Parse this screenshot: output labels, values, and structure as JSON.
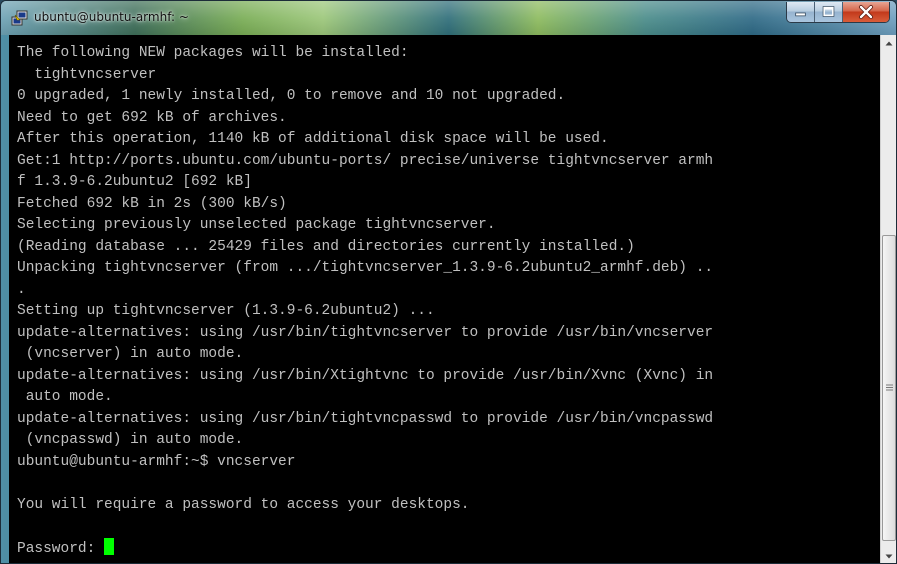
{
  "window": {
    "title": "ubuntu@ubuntu-armhf: ~"
  },
  "icons": {
    "app": "putty-icon",
    "minimize": "minimize-icon",
    "maximize": "maximize-icon",
    "close": "close-icon",
    "scroll_up": "scroll-up-arrow-icon",
    "scroll_down": "scroll-down-arrow-icon"
  },
  "terminal": {
    "lines": [
      "The following NEW packages will be installed:",
      "  tightvncserver",
      "0 upgraded, 1 newly installed, 0 to remove and 10 not upgraded.",
      "Need to get 692 kB of archives.",
      "After this operation, 1140 kB of additional disk space will be used.",
      "Get:1 http://ports.ubuntu.com/ubuntu-ports/ precise/universe tightvncserver armh",
      "f 1.3.9-6.2ubuntu2 [692 kB]",
      "Fetched 692 kB in 2s (300 kB/s)",
      "Selecting previously unselected package tightvncserver.",
      "(Reading database ... 25429 files and directories currently installed.)",
      "Unpacking tightvncserver (from .../tightvncserver_1.3.9-6.2ubuntu2_armhf.deb) ..",
      ".",
      "Setting up tightvncserver (1.3.9-6.2ubuntu2) ...",
      "update-alternatives: using /usr/bin/tightvncserver to provide /usr/bin/vncserver",
      " (vncserver) in auto mode.",
      "update-alternatives: using /usr/bin/Xtightvnc to provide /usr/bin/Xvnc (Xvnc) in",
      " auto mode.",
      "update-alternatives: using /usr/bin/tightvncpasswd to provide /usr/bin/vncpasswd",
      " (vncpasswd) in auto mode.",
      "ubuntu@ubuntu-armhf:~$ vncserver",
      "",
      "You will require a password to access your desktops.",
      ""
    ],
    "prompt": "Password: ",
    "text_color": "#c0c0c0",
    "background_color": "#000000",
    "cursor_color": "#00ff00"
  }
}
